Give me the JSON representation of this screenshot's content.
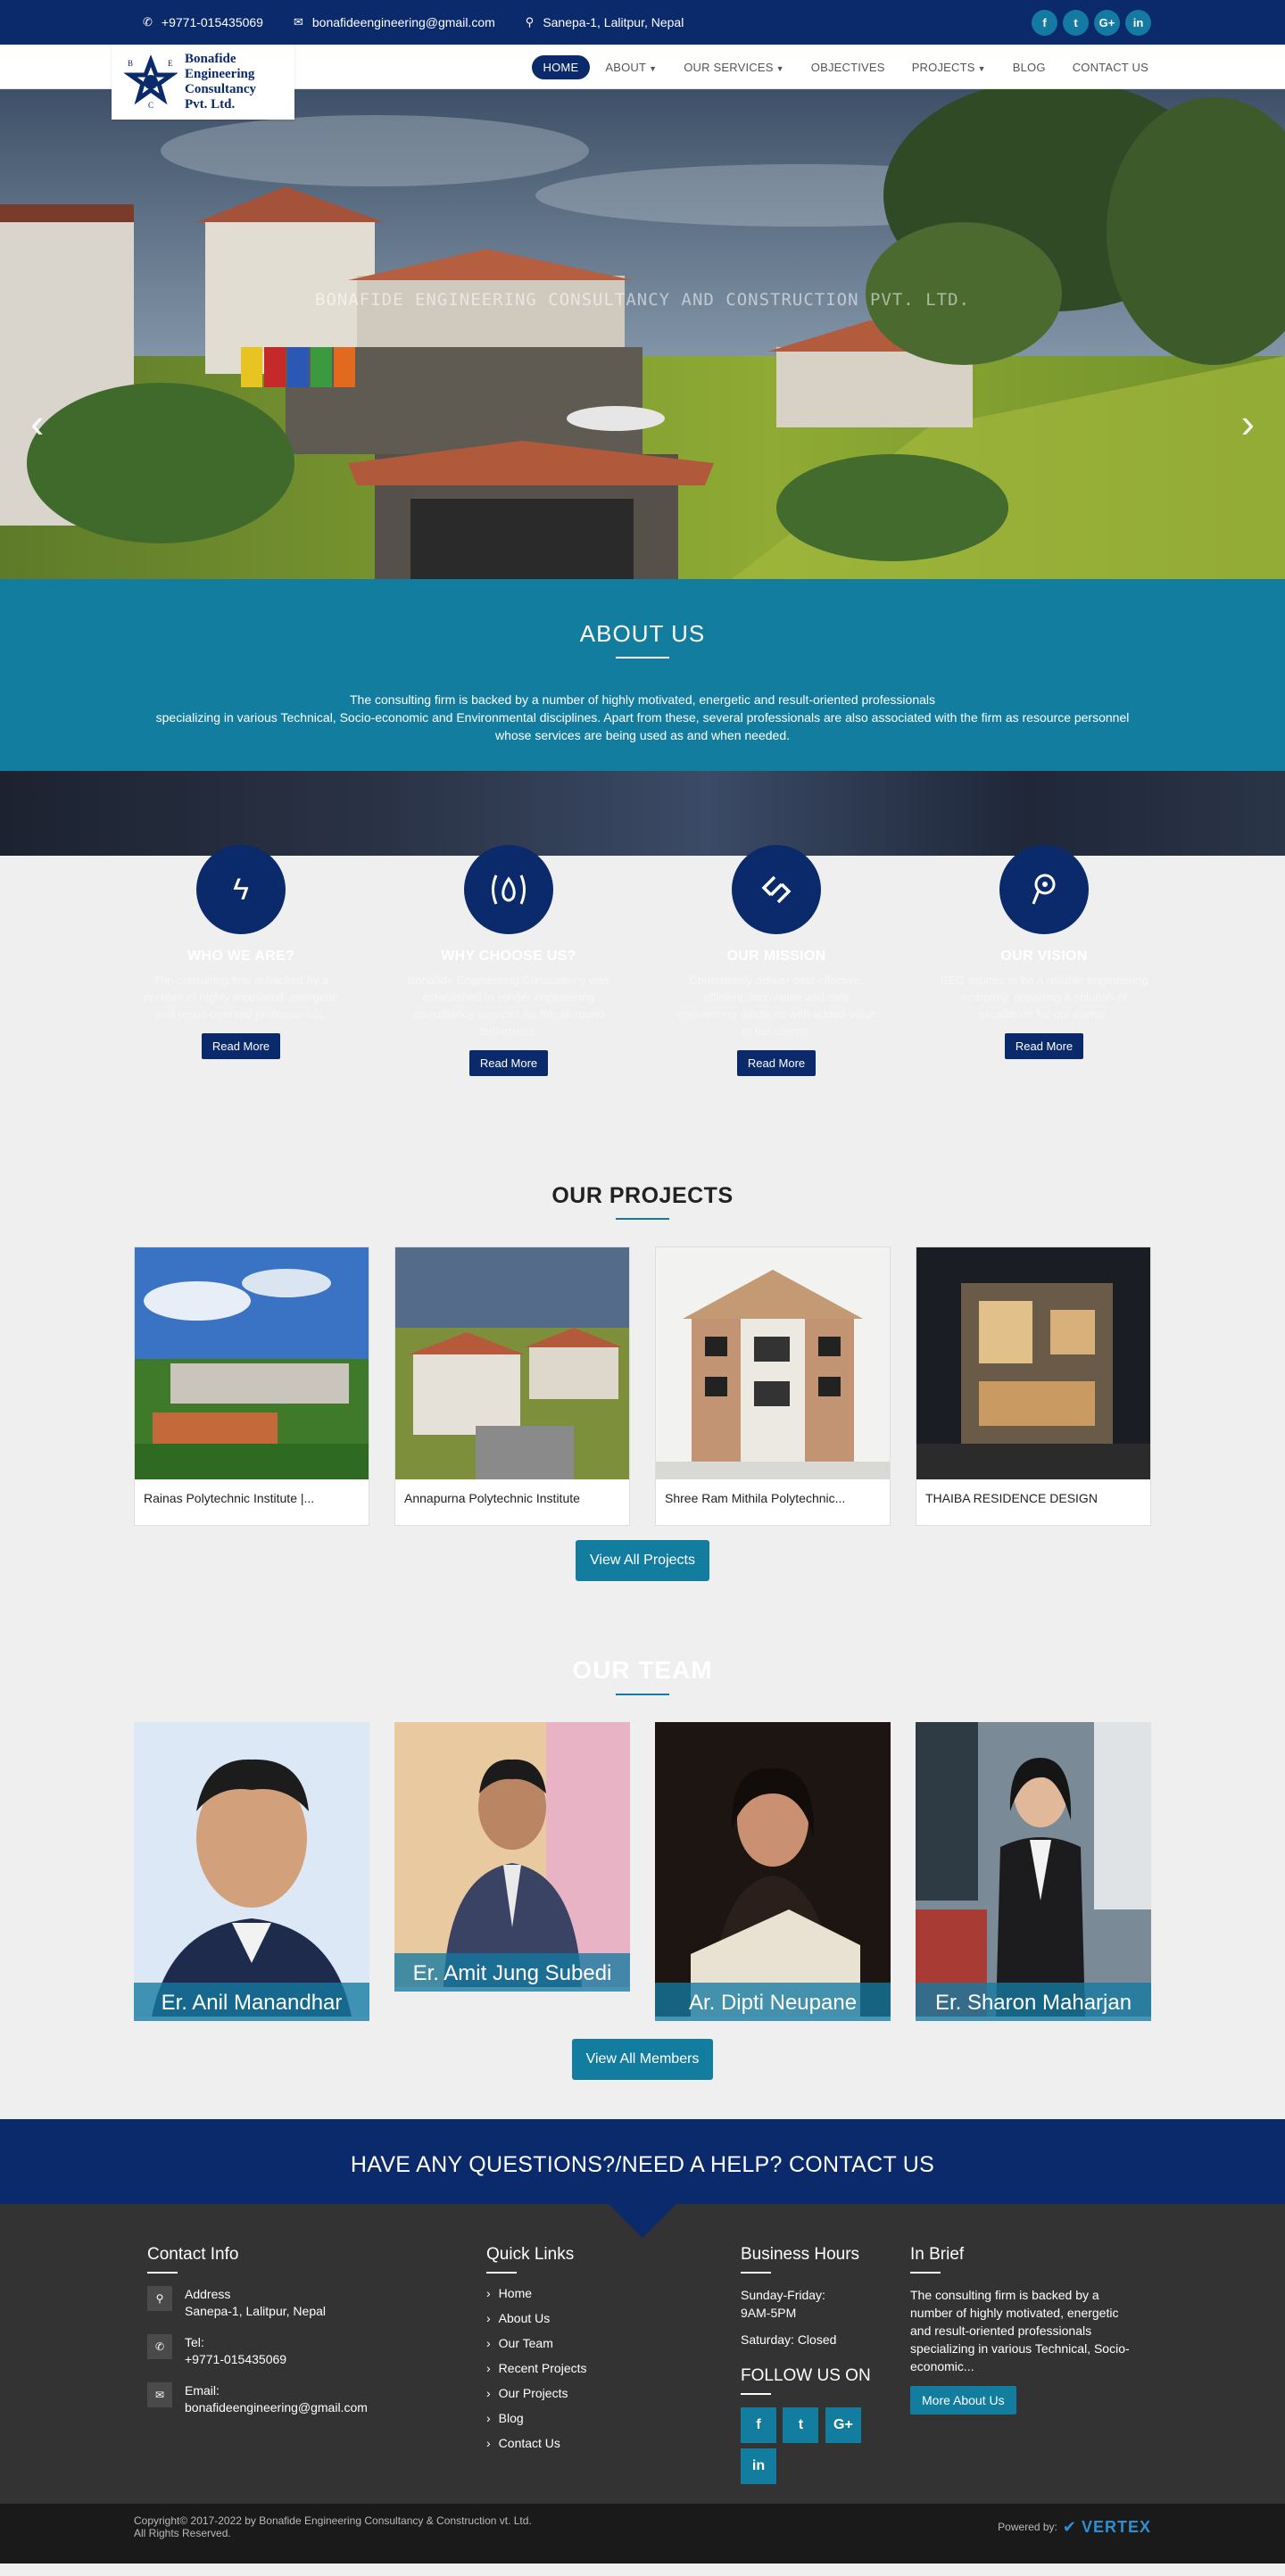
{
  "topbar": {
    "phone": "+9771-015435069",
    "email": "bonafideengineering@gmail.com",
    "address": "Sanepa-1, Lalitpur, Nepal",
    "social": [
      "f",
      "t",
      "G+",
      "in"
    ]
  },
  "brand": {
    "logo_letters": [
      "B",
      "E",
      "C"
    ],
    "name_line1": "Bonafide Engineering",
    "name_line2": "Consultancy Pvt. Ltd."
  },
  "nav": [
    {
      "label": "HOME",
      "active": true
    },
    {
      "label": "ABOUT",
      "dropdown": true
    },
    {
      "label": "OUR SERVICES",
      "dropdown": true
    },
    {
      "label": "OBJECTIVES"
    },
    {
      "label": "PROJECTS",
      "dropdown": true
    },
    {
      "label": "BLOG"
    },
    {
      "label": "CONTACT US"
    }
  ],
  "hero": {
    "caption": "BONAFIDE ENGINEERING CONSULTANCY AND CONSTRUCTION PVT. LTD.",
    "prev": "‹",
    "next": "›"
  },
  "about": {
    "title": "ABOUT US",
    "line1": "The consulting firm is backed by a number of highly motivated, energetic and result-oriented professionals",
    "line2": "specializing in various Technical, Socio-economic and Environmental disciplines. Apart from these, several professionals are also associated with the firm as resource personnel whose services are being used as and when needed."
  },
  "features": [
    {
      "icon": "bolt-icon",
      "glyph": "ϟ",
      "title": "WHO WE ARE?",
      "text": "The consulting firm is backed by a number of highly motivated, energetic and result-oriented professionals.",
      "button": "Read More"
    },
    {
      "icon": "fire-icon",
      "glyph": "(🔥)",
      "title": "WHY CHOOSE US?",
      "text": "Bonafide Engineering Consultancy was established to render engineering consultancy services for the all-round betterment.",
      "button": "Read More"
    },
    {
      "icon": "link-icon",
      "glyph": "⛓",
      "title": "OUR MISSION",
      "text": "Consistently deliver cost effective, efficient, innovative and safe engineering solutions with added value to our clients.",
      "button": "Read More"
    },
    {
      "icon": "pin-icon",
      "glyph": "℗",
      "title": "OUR VISION",
      "text": "BEC aspires to be a reliable engineering company, providing a solution of excellence for our clients.",
      "button": "Read More"
    }
  ],
  "projects": {
    "title": "OUR PROJECTS",
    "items": [
      {
        "caption": "Rainas Polytechnic Institute |..."
      },
      {
        "caption": "Annapurna Polytechnic Institute"
      },
      {
        "caption": "Shree Ram Mithila Polytechnic..."
      },
      {
        "caption": "THAIBA RESIDENCE DESIGN"
      }
    ],
    "button": "View All Projects"
  },
  "team": {
    "title": "OUR TEAM",
    "members": [
      {
        "name": "Er. Anil Manandhar"
      },
      {
        "name": "Er. Amit Jung Subedi"
      },
      {
        "name": "Ar. Dipti Neupane"
      },
      {
        "name": "Er. Sharon Maharjan"
      }
    ],
    "button": "View All Members"
  },
  "cta": "HAVE ANY QUESTIONS?/NEED A HELP? CONTACT US",
  "footer": {
    "contact": {
      "title": "Contact Info",
      "address_label": "Address",
      "address": "Sanepa-1, Lalitpur, Nepal",
      "tel_label": "Tel:",
      "tel": "+9771-015435069",
      "email_label": "Email:",
      "email": "bonafideengineering@gmail.com"
    },
    "quick": {
      "title": "Quick Links",
      "links": [
        "Home",
        "About Us",
        "Our Team",
        "Recent Projects",
        "Our Projects",
        "Blog",
        "Contact Us"
      ]
    },
    "hours": {
      "title": "Business Hours",
      "days": "Sunday-Friday:",
      "time": "9AM-5PM",
      "sat": "Saturday: Closed",
      "follow": "FOLLOW US ON",
      "social": [
        "f",
        "t",
        "G+",
        "in"
      ]
    },
    "brief": {
      "title": "In Brief",
      "text": "The consulting firm is backed by a number of highly motivated, energetic and result-oriented professionals specializing in various Technical, Socio-economic...",
      "button": "More About Us"
    }
  },
  "bottom": {
    "copyright": "Copyright© 2017-2022 by Bonafide Engineering Consultancy & Construction vt. Ltd.",
    "rights": "All Rights Reserved.",
    "powered": "Powered by:",
    "powered_brand": "VERTEX"
  }
}
